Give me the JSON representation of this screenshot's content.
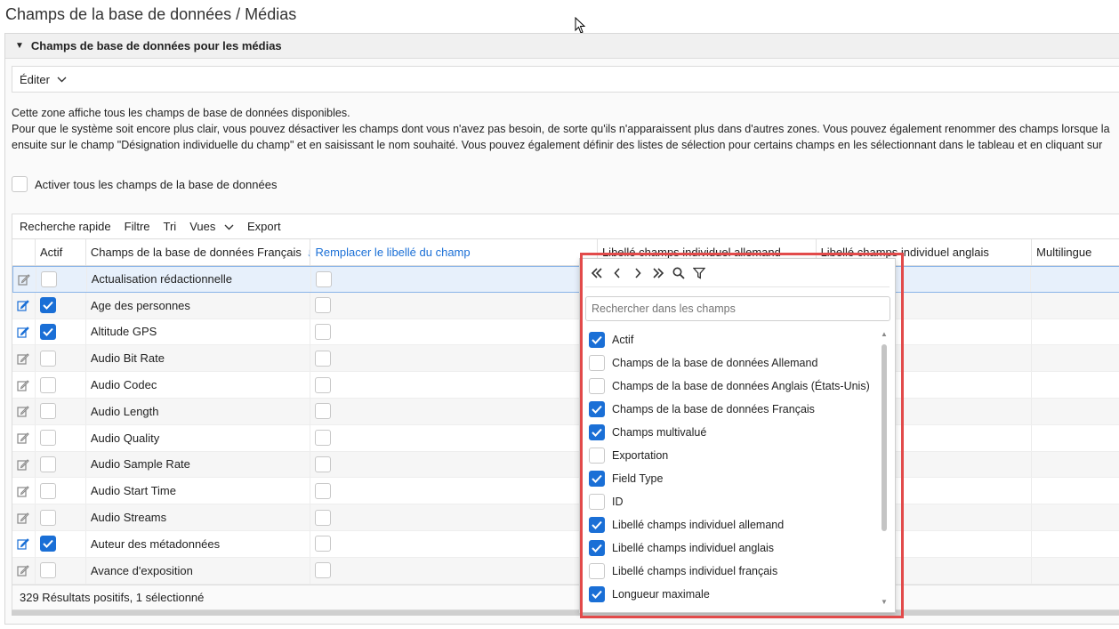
{
  "page": {
    "title": "Champs de la base de données / Médias"
  },
  "panel": {
    "header": "Champs de base de données pour les médias",
    "edit_label": "Éditer",
    "description": [
      "Cette zone affiche tous les champs de base de données disponibles.",
      "Pour que le système soit encore plus clair, vous pouvez désactiver les champs dont vous n'avez pas besoin, de sorte qu'ils n'apparaissent plus dans d'autres zones. Vous pouvez également renommer des champs lorsque la",
      "ensuite sur le champ \"Désignation individuelle du champ\" et en saisissant le nom souhaité. Vous pouvez également définir des listes de sélection pour certains champs en les sélectionnant dans le tableau et en cliquant sur"
    ],
    "activate_all_label": "Activer tous les champs de la base de données"
  },
  "grid_toolbar": {
    "quick_search": "Recherche rapide",
    "filter": "Filtre",
    "sort": "Tri",
    "views": "Vues",
    "export": "Export"
  },
  "grid": {
    "columns": [
      "Actif",
      "Champs de la base de données Français",
      "Remplacer le libellé du champ",
      "Libellé champs individuel allemand",
      "Libellé champs individuel anglais",
      "Multilingue"
    ],
    "rows": [
      {
        "name": "Actualisation rédactionnelle",
        "active": false,
        "selected": true
      },
      {
        "name": "Age des personnes",
        "active": true
      },
      {
        "name": "Altitude GPS",
        "active": true
      },
      {
        "name": "Audio Bit Rate",
        "active": false
      },
      {
        "name": "Audio Codec",
        "active": false
      },
      {
        "name": "Audio Length",
        "active": false
      },
      {
        "name": "Audio Quality",
        "active": false
      },
      {
        "name": "Audio Sample Rate",
        "active": false
      },
      {
        "name": "Audio Start Time",
        "active": false
      },
      {
        "name": "Audio Streams",
        "active": false
      },
      {
        "name": "Auteur des métadonnées",
        "active": true
      },
      {
        "name": "Avance d'exposition",
        "active": false
      }
    ],
    "footer": "329 Résultats positifs, 1 sélectionné"
  },
  "column_chooser": {
    "search_placeholder": "Rechercher dans les champs",
    "items": [
      {
        "label": "Actif",
        "checked": true
      },
      {
        "label": "Champs de la base de données Allemand",
        "checked": false
      },
      {
        "label": "Champs de la base de données Anglais (États-Unis)",
        "checked": false
      },
      {
        "label": "Champs de la base de données Français",
        "checked": true
      },
      {
        "label": "Champs multivalué",
        "checked": true
      },
      {
        "label": "Exportation",
        "checked": false
      },
      {
        "label": "Field Type",
        "checked": true
      },
      {
        "label": "ID",
        "checked": false
      },
      {
        "label": "Libellé champs individuel allemand",
        "checked": true
      },
      {
        "label": "Libellé champs individuel anglais",
        "checked": true
      },
      {
        "label": "Libellé champs individuel français",
        "checked": false
      },
      {
        "label": "Longueur maximale",
        "checked": true
      }
    ]
  },
  "colors": {
    "accent": "#1a6fd6",
    "highlight_frame": "#e24a4a"
  }
}
